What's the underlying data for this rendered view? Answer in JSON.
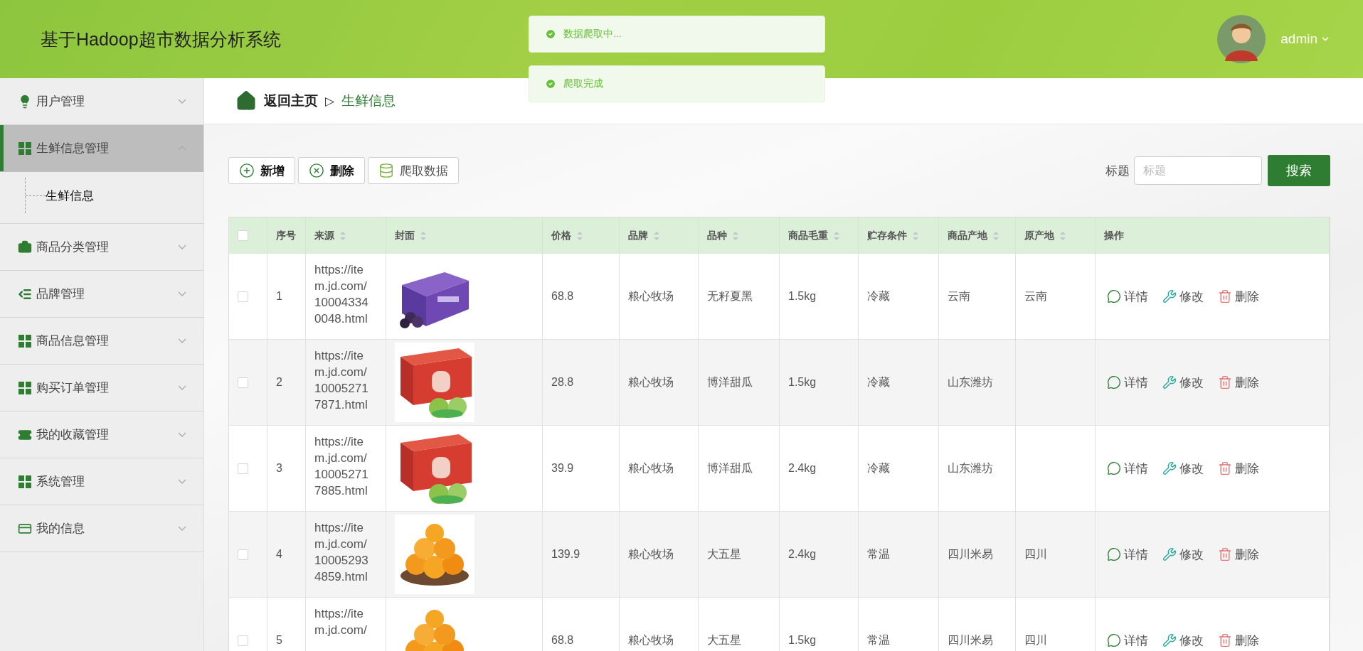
{
  "header": {
    "title": "基于Hadoop超市数据分析系统",
    "user": "admin"
  },
  "toasts": [
    {
      "text": "数据爬取中..."
    },
    {
      "text": "爬取完成"
    }
  ],
  "sidebar": {
    "items": [
      {
        "label": "用户管理",
        "expanded": false,
        "selected": false
      },
      {
        "label": "生鲜信息管理",
        "expanded": true,
        "selected": true,
        "children": [
          {
            "label": "生鲜信息"
          }
        ]
      },
      {
        "label": "商品分类管理",
        "expanded": false,
        "selected": false
      },
      {
        "label": "品牌管理",
        "expanded": false,
        "selected": false
      },
      {
        "label": "商品信息管理",
        "expanded": false,
        "selected": false
      },
      {
        "label": "购买订单管理",
        "expanded": false,
        "selected": false
      },
      {
        "label": "我的收藏管理",
        "expanded": false,
        "selected": false
      },
      {
        "label": "系统管理",
        "expanded": false,
        "selected": false
      },
      {
        "label": "我的信息",
        "expanded": false,
        "selected": false
      }
    ]
  },
  "breadcrumb": {
    "home": "返回主页",
    "separator": "▷",
    "current": "生鲜信息"
  },
  "toolbar": {
    "buttons": [
      {
        "label": "新增",
        "kind": "add"
      },
      {
        "label": "删除",
        "kind": "delete"
      },
      {
        "label": "爬取数据",
        "kind": "crawl"
      }
    ],
    "search": {
      "label": "标题",
      "placeholder": "标题",
      "button": "搜索"
    }
  },
  "table": {
    "all_checked": false,
    "columns": [
      {
        "label": "序号",
        "sortable": false
      },
      {
        "label": "来源",
        "sortable": true
      },
      {
        "label": "封面",
        "sortable": true
      },
      {
        "label": "价格",
        "sortable": true
      },
      {
        "label": "品牌",
        "sortable": true
      },
      {
        "label": "品种",
        "sortable": true
      },
      {
        "label": "商品毛重",
        "sortable": true
      },
      {
        "label": "贮存条件",
        "sortable": true
      },
      {
        "label": "商品产地",
        "sortable": true
      },
      {
        "label": "原产地",
        "sortable": true
      },
      {
        "label": "操作",
        "sortable": false
      }
    ],
    "rows": [
      {
        "checked": false,
        "no": "1",
        "source": "https://item.jd.com/100043340048.html",
        "price": "68.8",
        "brand": "粮心牧场",
        "variety": "无籽夏黑",
        "weight": "1.5kg",
        "storage": "冷藏",
        "place": "云南",
        "origin": "云南",
        "actions": [
          {
            "label": "详情",
            "kind": "detail"
          },
          {
            "label": "修改",
            "kind": "edit"
          },
          {
            "label": "删除",
            "kind": "delete"
          }
        ]
      },
      {
        "checked": false,
        "no": "2",
        "source": "https://item.jd.com/100052717871.html",
        "price": "28.8",
        "brand": "粮心牧场",
        "variety": "博洋甜瓜",
        "weight": "1.5kg",
        "storage": "冷藏",
        "place": "山东潍坊",
        "actions": [
          {
            "label": "详情",
            "kind": "detail"
          },
          {
            "label": "修改",
            "kind": "edit"
          },
          {
            "label": "删除",
            "kind": "delete"
          }
        ]
      },
      {
        "checked": false,
        "no": "3",
        "source": "https://item.jd.com/100052717885.html",
        "price": "39.9",
        "brand": "粮心牧场",
        "variety": "博洋甜瓜",
        "weight": "2.4kg",
        "storage": "冷藏",
        "place": "山东潍坊",
        "actions": [
          {
            "label": "详情",
            "kind": "detail"
          },
          {
            "label": "修改",
            "kind": "edit"
          },
          {
            "label": "删除",
            "kind": "delete"
          }
        ]
      },
      {
        "checked": false,
        "no": "4",
        "source": "https://item.jd.com/100052934859.html",
        "price": "139.9",
        "brand": "粮心牧场",
        "variety": "大五星",
        "weight": "2.4kg",
        "storage": "常温",
        "place": "四川米易",
        "origin": "四川",
        "actions": [
          {
            "label": "详情",
            "kind": "detail"
          },
          {
            "label": "修改",
            "kind": "edit"
          },
          {
            "label": "删除",
            "kind": "delete"
          }
        ]
      },
      {
        "checked": false,
        "no": "5",
        "source": "https://item.jd.com/",
        "price": "68.8",
        "brand": "粮心牧场",
        "variety": "大五星",
        "weight": "1.5kg",
        "storage": "常温",
        "place": "四川米易",
        "origin": "四川",
        "actions": [
          {
            "label": "详情",
            "kind": "detail"
          },
          {
            "label": "修改",
            "kind": "edit"
          },
          {
            "label": "删除",
            "kind": "delete"
          }
        ]
      }
    ]
  }
}
